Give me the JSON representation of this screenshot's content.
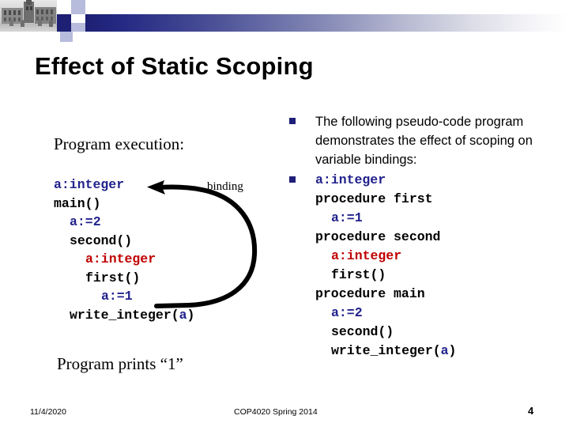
{
  "slide": {
    "title": "Effect of Static Scoping"
  },
  "left": {
    "heading": "Program execution:",
    "code_lines": [
      {
        "indent": 0,
        "segments": [
          {
            "text": "a:integer",
            "color": "blue"
          }
        ]
      },
      {
        "indent": 0,
        "segments": [
          {
            "text": "main()",
            "color": "black"
          }
        ]
      },
      {
        "indent": 1,
        "segments": [
          {
            "text": "a:=2",
            "color": "blue"
          }
        ]
      },
      {
        "indent": 1,
        "segments": [
          {
            "text": "second()",
            "color": "black"
          }
        ]
      },
      {
        "indent": 2,
        "segments": [
          {
            "text": "a:integer",
            "color": "red"
          }
        ]
      },
      {
        "indent": 2,
        "segments": [
          {
            "text": "first()",
            "color": "black"
          }
        ]
      },
      {
        "indent": 3,
        "segments": [
          {
            "text": "a:=1",
            "color": "blue"
          }
        ]
      },
      {
        "indent": 1,
        "segments": [
          {
            "text": "write_integer(",
            "color": "black"
          },
          {
            "text": "a",
            "color": "blue"
          },
          {
            "text": ")",
            "color": "black"
          }
        ]
      }
    ],
    "binding_label": "binding",
    "result": "Program prints “1”"
  },
  "right": {
    "bullets": [
      {
        "kind": "text",
        "text": "The following pseudo-code program demonstrates the effect of scoping on variable bindings:"
      },
      {
        "kind": "code",
        "code_lines": [
          {
            "indent": 0,
            "segments": [
              {
                "text": "a:integer",
                "color": "blue"
              }
            ]
          },
          {
            "indent": 0,
            "segments": [
              {
                "text": "procedure first",
                "color": "black"
              }
            ]
          },
          {
            "indent": 1,
            "segments": [
              {
                "text": "a:=1",
                "color": "blue"
              }
            ]
          },
          {
            "indent": 0,
            "segments": [
              {
                "text": "procedure second",
                "color": "black"
              }
            ]
          },
          {
            "indent": 1,
            "segments": [
              {
                "text": "a:integer",
                "color": "red"
              }
            ]
          },
          {
            "indent": 1,
            "segments": [
              {
                "text": "first()",
                "color": "black"
              }
            ]
          },
          {
            "indent": 0,
            "segments": [
              {
                "text": "procedure main",
                "color": "black"
              }
            ]
          },
          {
            "indent": 1,
            "segments": [
              {
                "text": "a:=2",
                "color": "blue"
              }
            ]
          },
          {
            "indent": 1,
            "segments": [
              {
                "text": "second()",
                "color": "black"
              }
            ]
          },
          {
            "indent": 1,
            "segments": [
              {
                "text": "write_integer(",
                "color": "black"
              },
              {
                "text": "a",
                "color": "blue"
              },
              {
                "text": ")",
                "color": "black"
              }
            ]
          }
        ]
      }
    ]
  },
  "footer": {
    "date": "11/4/2020",
    "course": "COP4020 Spring 2014",
    "page": "4"
  },
  "colors": {
    "code_blue": "#22228c",
    "code_red": "#c00000",
    "code_black": "#000000",
    "bullet_navy": "#1f1f7a",
    "banner_navy": "#1d2073"
  }
}
